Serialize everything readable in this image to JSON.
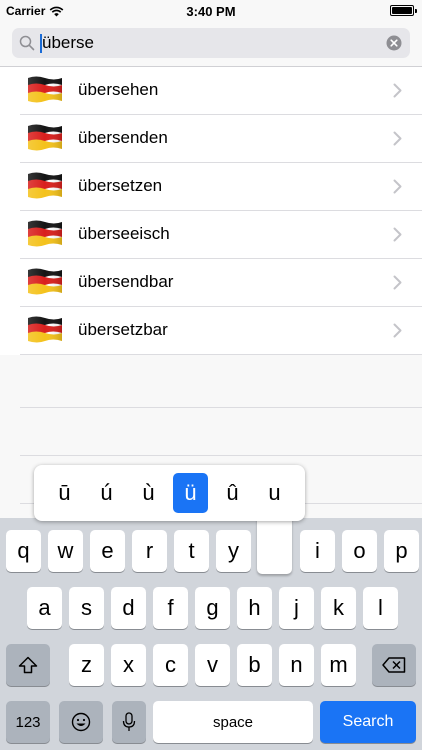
{
  "status_bar": {
    "carrier": "Carrier",
    "time": "3:40 PM"
  },
  "search": {
    "value": "überse"
  },
  "results": [
    {
      "label": "übersehen",
      "icon": "german-flag-icon"
    },
    {
      "label": "übersenden",
      "icon": "german-flag-icon"
    },
    {
      "label": "übersetzen",
      "icon": "german-flag-icon"
    },
    {
      "label": "überseeisch",
      "icon": "german-flag-icon"
    },
    {
      "label": "übersendbar",
      "icon": "german-flag-icon"
    },
    {
      "label": "übersetzbar",
      "icon": "german-flag-icon"
    }
  ],
  "accent_popup": {
    "options": [
      "ū",
      "ú",
      "ù",
      "ü",
      "û",
      "u"
    ],
    "selected": "ü"
  },
  "keyboard": {
    "row1": [
      "q",
      "w",
      "e",
      "r",
      "t",
      "y",
      "u",
      "i",
      "o",
      "p"
    ],
    "row2": [
      "a",
      "s",
      "d",
      "f",
      "g",
      "h",
      "j",
      "k",
      "l"
    ],
    "row3": [
      "z",
      "x",
      "c",
      "v",
      "b",
      "n",
      "m"
    ],
    "numbers_label": "123",
    "space_label": "space",
    "search_label": "Search"
  },
  "colors": {
    "accent": "#1a74f5",
    "keyboard_bg": "#d1d5db"
  }
}
